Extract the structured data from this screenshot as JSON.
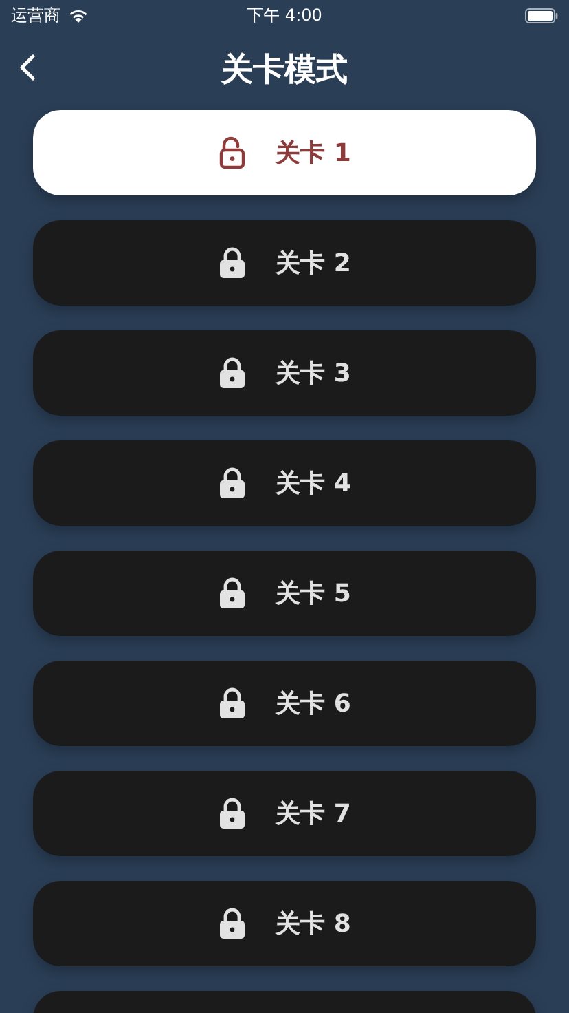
{
  "status_bar": {
    "carrier": "运营商",
    "time": "下午 4:00"
  },
  "nav": {
    "title": "关卡模式"
  },
  "levels": [
    {
      "label": "关卡 1",
      "unlocked": true
    },
    {
      "label": "关卡 2",
      "unlocked": false
    },
    {
      "label": "关卡 3",
      "unlocked": false
    },
    {
      "label": "关卡 4",
      "unlocked": false
    },
    {
      "label": "关卡 5",
      "unlocked": false
    },
    {
      "label": "关卡 6",
      "unlocked": false
    },
    {
      "label": "关卡 7",
      "unlocked": false
    },
    {
      "label": "关卡 8",
      "unlocked": false
    },
    {
      "unlocked": false
    }
  ]
}
